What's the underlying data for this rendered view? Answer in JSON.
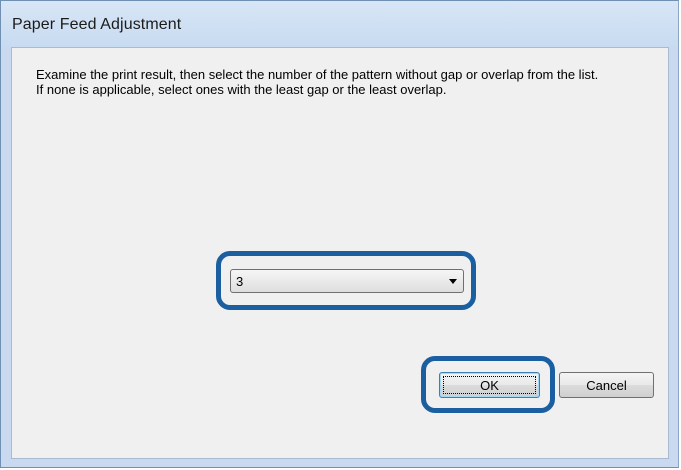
{
  "window": {
    "title": "Paper Feed Adjustment"
  },
  "instructions": {
    "line1": "Examine the print result, then select the number of the pattern without gap or overlap from the list.",
    "line2": "If none is applicable, select ones with the least gap or the least overlap."
  },
  "pattern_select": {
    "selected_value": "3"
  },
  "buttons": {
    "ok_label": "OK",
    "cancel_label": "Cancel"
  },
  "colors": {
    "title_bar": "#c8dbf1",
    "client_bg": "#f0f0f0",
    "highlight": "#1c5fa0"
  }
}
